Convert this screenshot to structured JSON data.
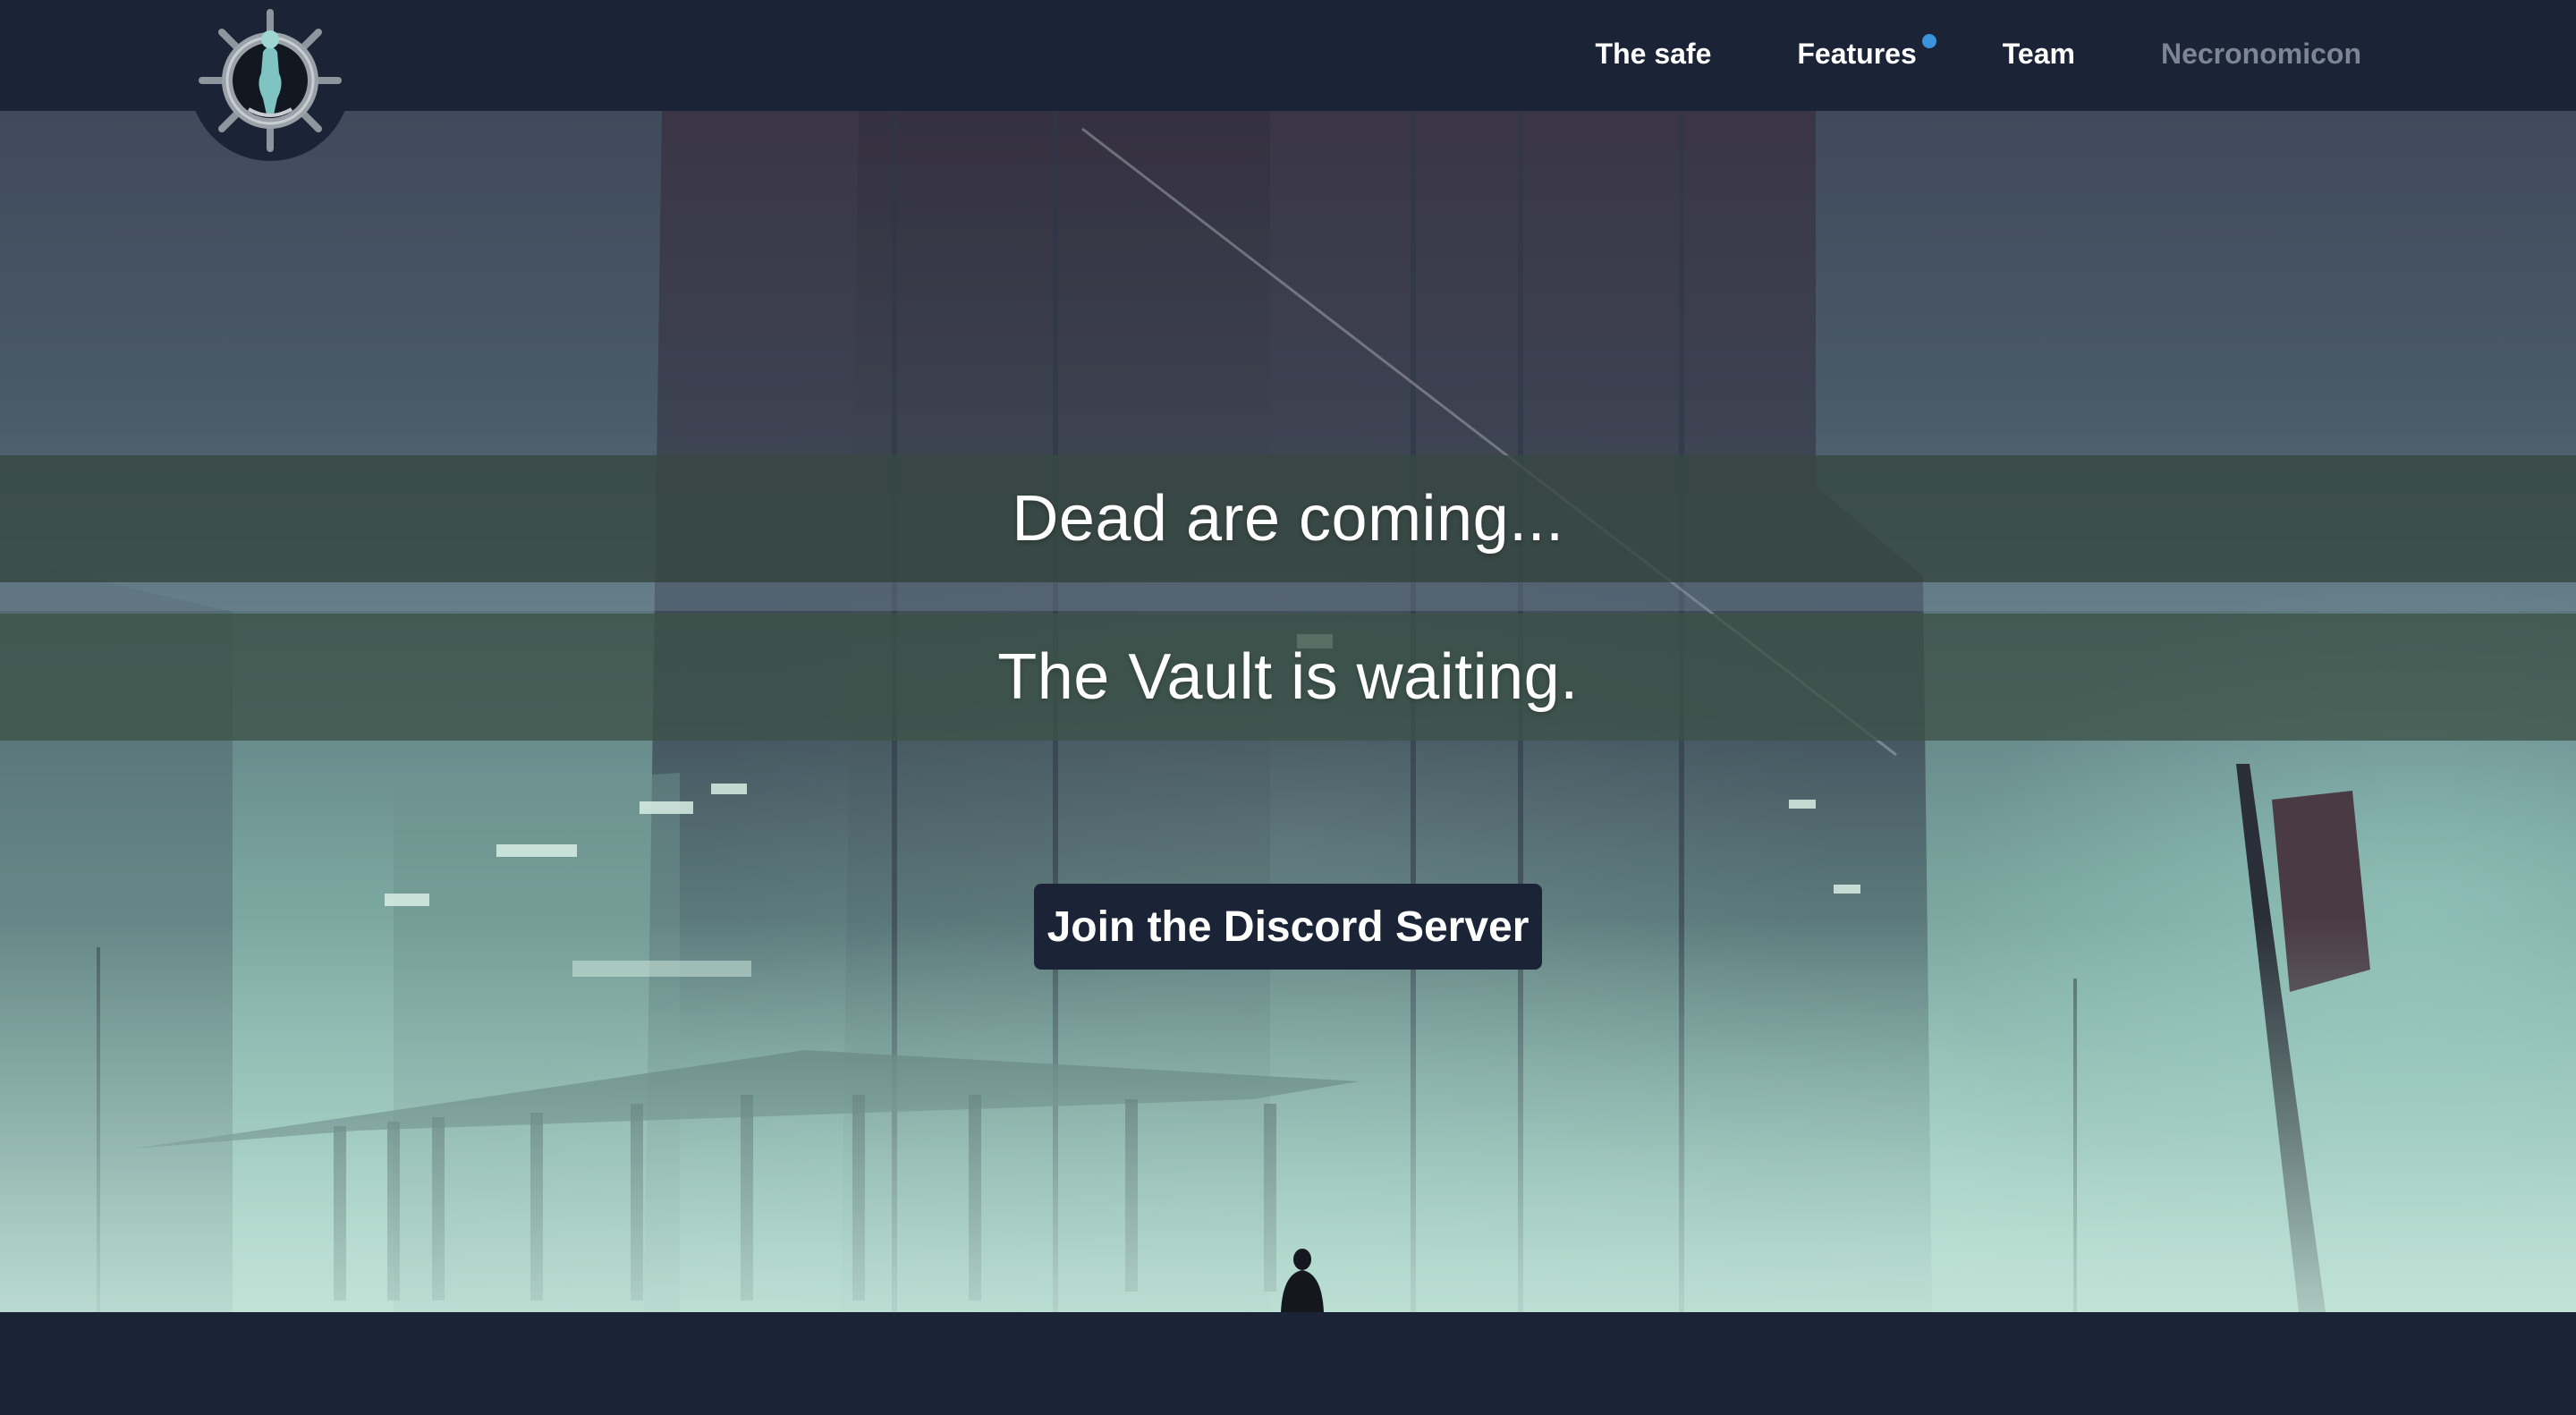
{
  "navbar": {
    "logo_icon": "vault-wheel-logo-icon",
    "links": [
      {
        "label": "The safe",
        "muted": false
      },
      {
        "label": "Features",
        "muted": false,
        "badge": "notification-dot"
      },
      {
        "label": "Team",
        "muted": false
      },
      {
        "label": "Necronomicon",
        "muted": true
      }
    ]
  },
  "hero": {
    "headline": "Dead are coming...",
    "subheadline": "The Vault is waiting.",
    "cta_label": "Join the Discord Server"
  },
  "colors": {
    "navbar_bg": "#1b2436",
    "button_bg": "#1b2436",
    "text_primary": "#ffffff",
    "text_muted": "#7d8594",
    "notification_dot": "#3a93db"
  }
}
